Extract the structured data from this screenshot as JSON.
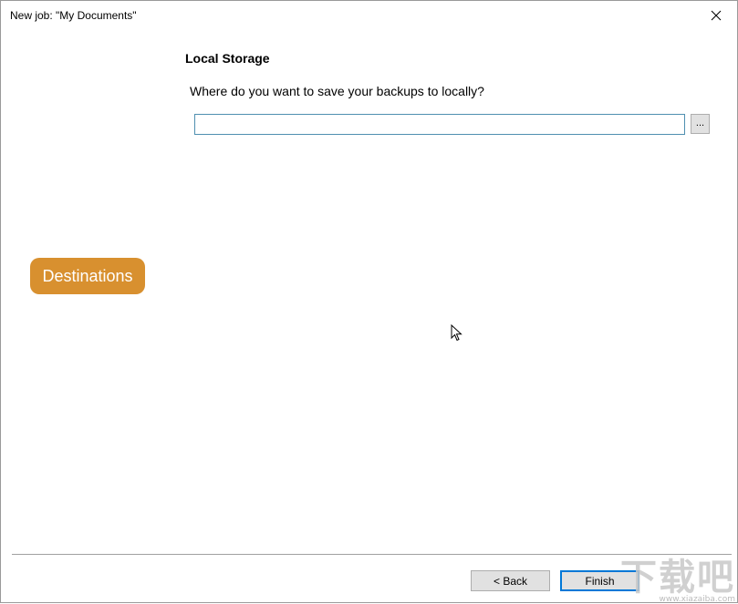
{
  "window": {
    "title": "New job: \"My Documents\"",
    "close_label": "✕"
  },
  "main": {
    "section_title": "Local Storage",
    "question": "Where do you want to save your backups to locally?",
    "path_value": "",
    "browse_label": "..."
  },
  "sidebar": {
    "badge_label": "Destinations",
    "badge_color": "#d8902f"
  },
  "footer": {
    "back_label": "< Back",
    "finish_label": "Finish"
  },
  "watermark": {
    "chars": "下载吧",
    "url": "www.xiazaiba.com"
  },
  "icons": {
    "close": "close-icon",
    "cursor": "mouse-pointer-icon"
  }
}
